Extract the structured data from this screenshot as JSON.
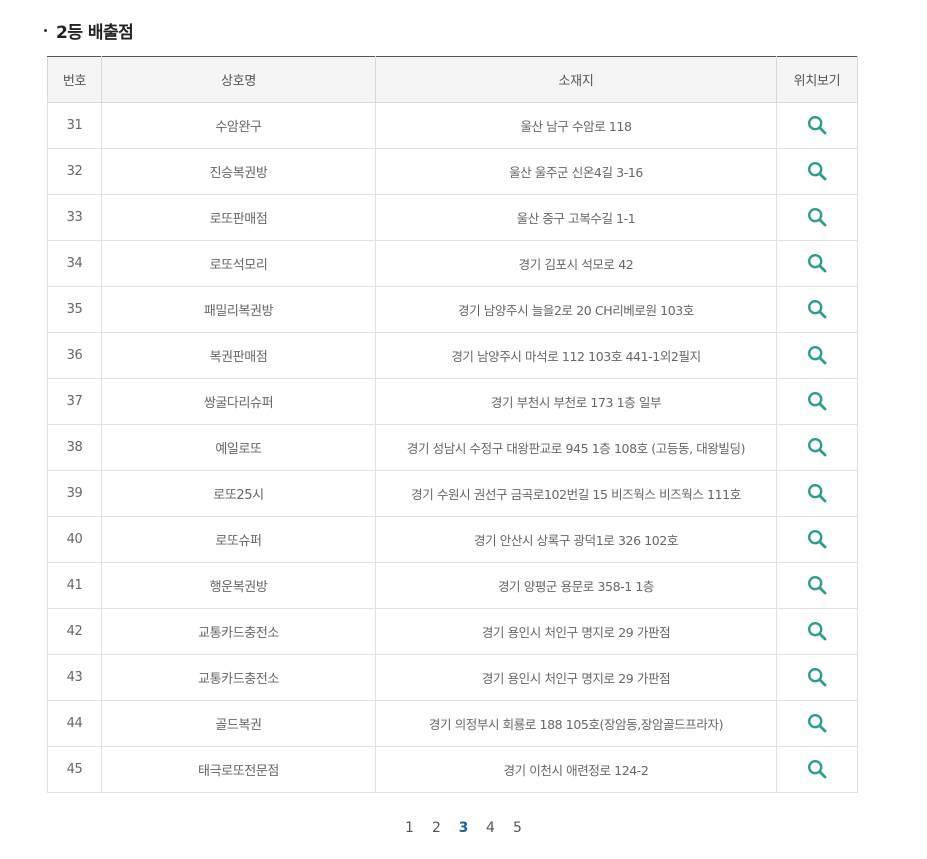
{
  "section": {
    "title": "2등 배출점"
  },
  "table": {
    "headers": {
      "no": "번호",
      "name": "상호명",
      "address": "소재지",
      "location": "위치보기"
    },
    "rows": [
      {
        "no": "31",
        "name": "수암완구",
        "address": "울산 남구 수암로 118"
      },
      {
        "no": "32",
        "name": "진승복권방",
        "address": "울산 울주군 신온4길 3-16"
      },
      {
        "no": "33",
        "name": "로또판매점",
        "address": "울산 중구 고복수길 1-1"
      },
      {
        "no": "34",
        "name": "로또석모리",
        "address": "경기 김포시 석모로 42"
      },
      {
        "no": "35",
        "name": "패밀리복권방",
        "address": "경기 남양주시 늘을2로 20 CH리베로원 103호"
      },
      {
        "no": "36",
        "name": "복권판매점",
        "address": "경기 남양주시 마석로 112 103호 441-1외2필지"
      },
      {
        "no": "37",
        "name": "쌍굴다리슈퍼",
        "address": "경기 부천시 부천로 173 1층 일부"
      },
      {
        "no": "38",
        "name": "예일로또",
        "address": "경기 성남시 수정구 대왕판교로 945 1층 108호 (고등동, 대왕빌딩)"
      },
      {
        "no": "39",
        "name": "로또25시",
        "address": "경기 수원시 권선구 금곡로102번길 15 비즈웍스 비즈웍스 111호"
      },
      {
        "no": "40",
        "name": "로또슈퍼",
        "address": "경기 안산시 상록구 광덕1로 326 102호"
      },
      {
        "no": "41",
        "name": "행운복권방",
        "address": "경기 양평군 용문로 358-1 1층"
      },
      {
        "no": "42",
        "name": "교통카드충전소",
        "address": "경기 용인시 처인구 명지로 29 가판점"
      },
      {
        "no": "43",
        "name": "교통카드충전소",
        "address": "경기 용인시 처인구 명지로 29 가판점"
      },
      {
        "no": "44",
        "name": "골드복권",
        "address": "경기 의정부시 회룡로 188 105호(장암동,장암골드프라자)"
      },
      {
        "no": "45",
        "name": "태극로또전문점",
        "address": "경기 이천시 애련정로 124-2"
      }
    ],
    "location_icon": "search-icon",
    "icon_color": "#2a9d8f"
  },
  "pagination": {
    "pages": [
      "1",
      "2",
      "3",
      "4",
      "5"
    ],
    "current": "3",
    "active_color": "#1a5fa0"
  }
}
